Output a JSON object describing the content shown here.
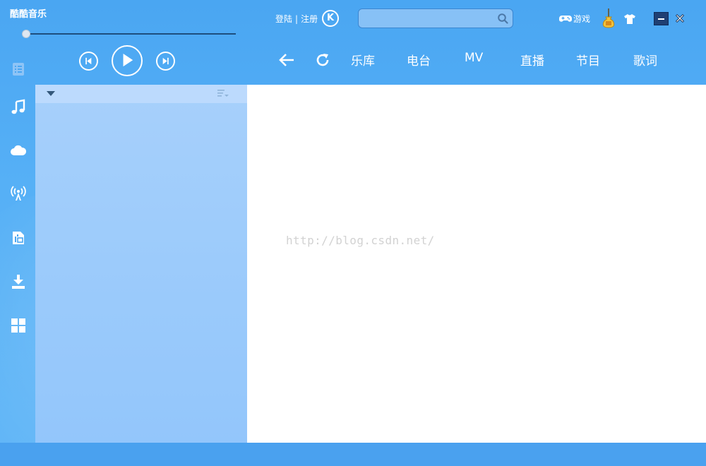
{
  "app": {
    "title": "酷酷音乐",
    "login_label": "登陆",
    "separator": "|",
    "register_label": "注册",
    "logo_letter": "K",
    "games_label": "游戏"
  },
  "player": {
    "progress_fraction": 0.01
  },
  "search": {
    "placeholder": ""
  },
  "nav": {
    "tabs": [
      {
        "label": "乐库"
      },
      {
        "label": "电台"
      },
      {
        "label": "MV"
      },
      {
        "label": "直播"
      },
      {
        "label": "节目"
      },
      {
        "label": "歌词"
      }
    ]
  },
  "content": {
    "watermark": "http://blog.csdn.net/"
  },
  "colors": {
    "accent": "#4aa6f2",
    "panel": "#9ccbfb",
    "panel_header": "#bcdafd"
  },
  "icons": {
    "sidebar": [
      "playlist-icon",
      "music-note-icon",
      "cloud-icon",
      "radio-antenna-icon",
      "local-library-icon",
      "download-icon",
      "apps-grid-icon"
    ]
  }
}
